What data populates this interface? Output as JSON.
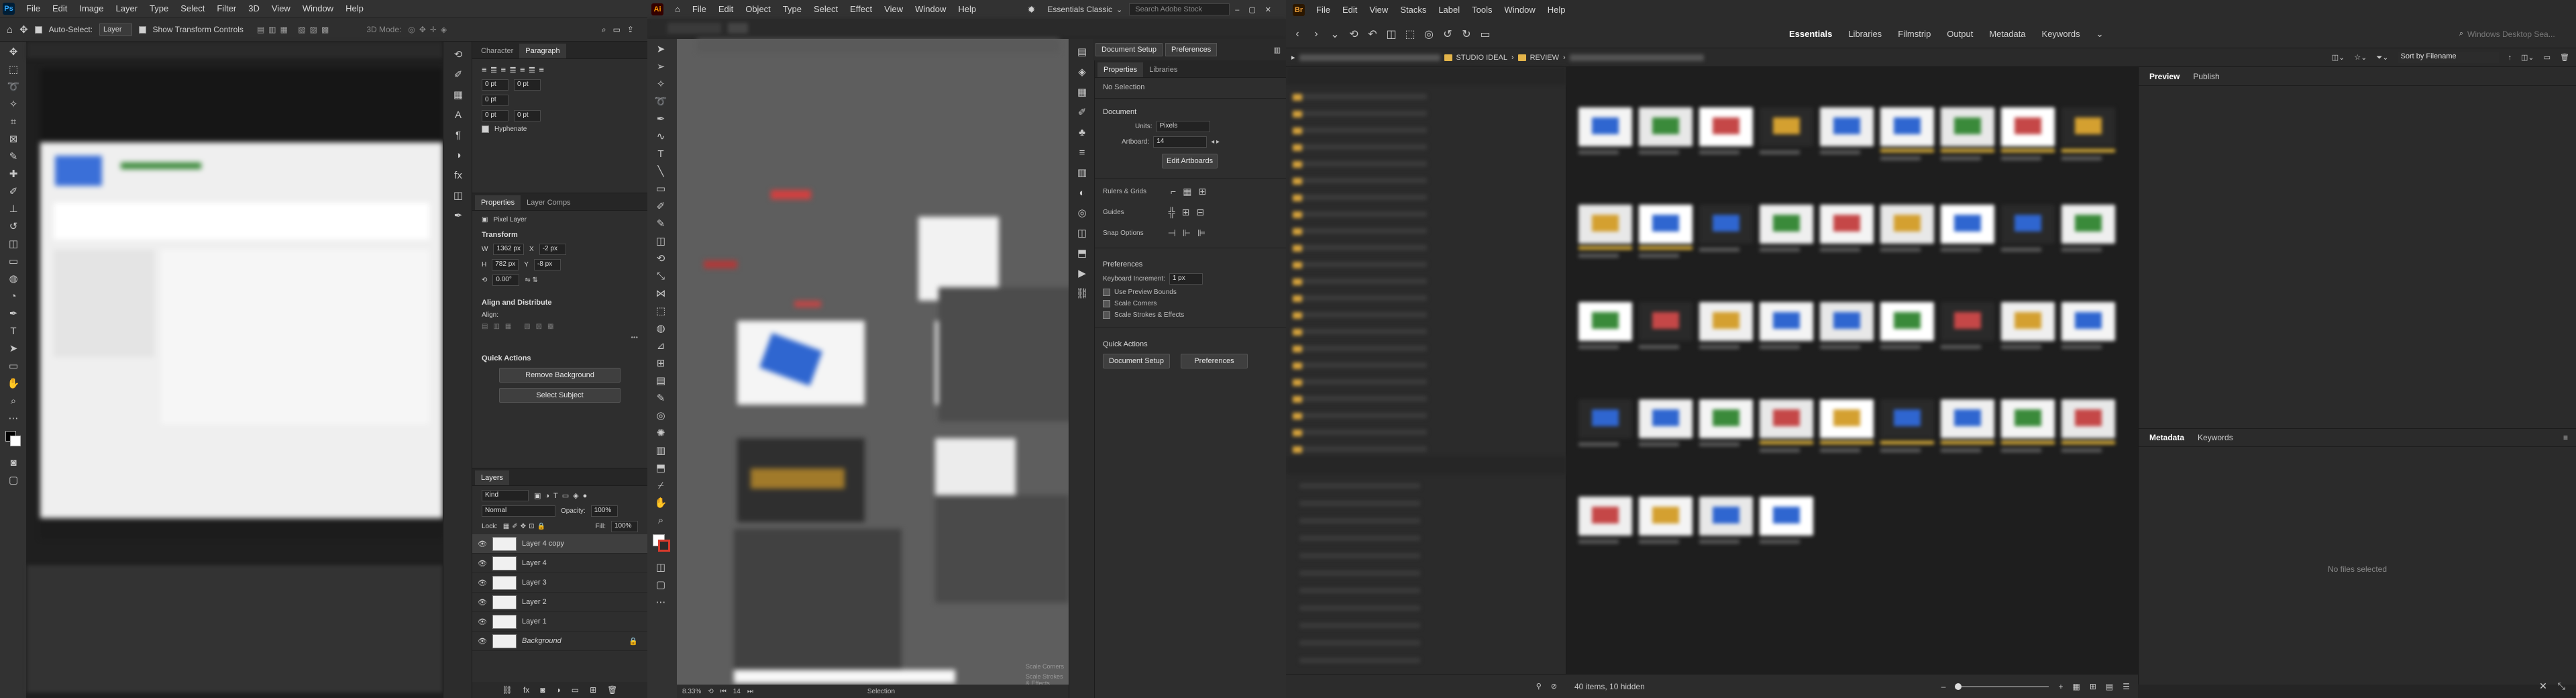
{
  "photoshop": {
    "logo": "Ps",
    "menu": [
      "File",
      "Edit",
      "Image",
      "Layer",
      "Type",
      "Select",
      "Filter",
      "3D",
      "View",
      "Window",
      "Help"
    ],
    "options": {
      "auto_select_label": "Auto-Select:",
      "auto_select_value": "Layer",
      "show_transform_label": "Show Transform Controls",
      "mode_3d_label": "3D Mode:"
    },
    "panel_tabs_top": [
      "Character",
      "Paragraph"
    ],
    "panel_tabs_mid": [
      "Properties",
      "Layer Comps"
    ],
    "paragraph": {
      "fields": [
        "0 pt",
        "0 pt",
        "0 pt",
        "0 pt",
        "0 pt"
      ],
      "hyphenate_label": "Hyphenate"
    },
    "properties": {
      "kind": "Pixel Layer",
      "transform_title": "Transform",
      "w_label": "W",
      "w_value": "1362 px",
      "x_label": "X",
      "x_value": "-2 px",
      "h_label": "H",
      "h_value": "782 px",
      "y_label": "Y",
      "y_value": "-8 px",
      "angle_value": "0.00°",
      "align_title": "Align and Distribute",
      "align_label": "Align:",
      "quick_title": "Quick Actions",
      "remove_bg": "Remove Background",
      "select_subject": "Select Subject"
    },
    "layers_panel": {
      "title": "Layers",
      "filter_kind": "Kind",
      "blend_mode": "Normal",
      "opacity_label": "Opacity:",
      "opacity_value": "100%",
      "lock_label": "Lock:",
      "fill_label": "Fill:",
      "fill_value": "100%",
      "layers": [
        {
          "name": "Layer 4 copy",
          "active": true
        },
        {
          "name": "Layer 4",
          "active": false
        },
        {
          "name": "Layer 3",
          "active": false
        },
        {
          "name": "Layer 2",
          "active": false
        },
        {
          "name": "Layer 1",
          "active": false
        },
        {
          "name": "Background",
          "active": false
        }
      ]
    }
  },
  "illustrator": {
    "logo": "Ai",
    "menu": [
      "File",
      "Edit",
      "Object",
      "Type",
      "Select",
      "Effect",
      "View",
      "Window",
      "Help"
    ],
    "workspace": "Essentials Classic",
    "search_placeholder": "Search Adobe Stock",
    "doc_setup_btn": "Document Setup",
    "prefs_btn": "Preferences",
    "prop_tabs": [
      "Properties",
      "Libraries"
    ],
    "no_selection": "No Selection",
    "document_label": "Document",
    "units_label": "Units:",
    "units_value": "Pixels",
    "artboard_label": "Artboard:",
    "artboard_value": "14",
    "edit_artboards": "Edit Artboards",
    "rulers_label": "Rulers & Grids",
    "guides_label": "Guides",
    "snap_label": "Snap Options",
    "preferences_label": "Preferences",
    "keyboard_inc_label": "Keyboard Increment:",
    "keyboard_inc_value": "1 px",
    "use_preview_bounds": "Use Preview Bounds",
    "scale_corners": "Scale Corners",
    "scale_strokes": "Scale Strokes & Effects",
    "quick_actions": "Quick Actions",
    "qa_doc_setup": "Document Setup",
    "qa_prefs": "Preferences",
    "status_zoom": "8.33%",
    "status_artboard": "14",
    "status_tool": "Selection",
    "canvas_labels": {
      "scale_corners": "Scale Corners",
      "scale_strokes": "Scale Strokes & Effects"
    }
  },
  "bridge": {
    "logo": "Br",
    "menu": [
      "File",
      "Edit",
      "View",
      "Stacks",
      "Label",
      "Tools",
      "Window",
      "Help"
    ],
    "workspaces": [
      "Essentials",
      "Libraries",
      "Filmstrip",
      "Output",
      "Metadata",
      "Keywords"
    ],
    "active_workspace": "Essentials",
    "search_placeholder": "Windows Desktop Sea...",
    "breadcrumb": [
      "STUDIO IDEAL",
      "REVIEW"
    ],
    "sort_label": "Sort by Filename",
    "preview_tabs": [
      "Preview",
      "Publish"
    ],
    "metadata_tabs": [
      "Metadata",
      "Keywords"
    ],
    "no_files": "No files selected",
    "status_items": "40 items, 10 hidden",
    "accent": "#e0b33a"
  }
}
